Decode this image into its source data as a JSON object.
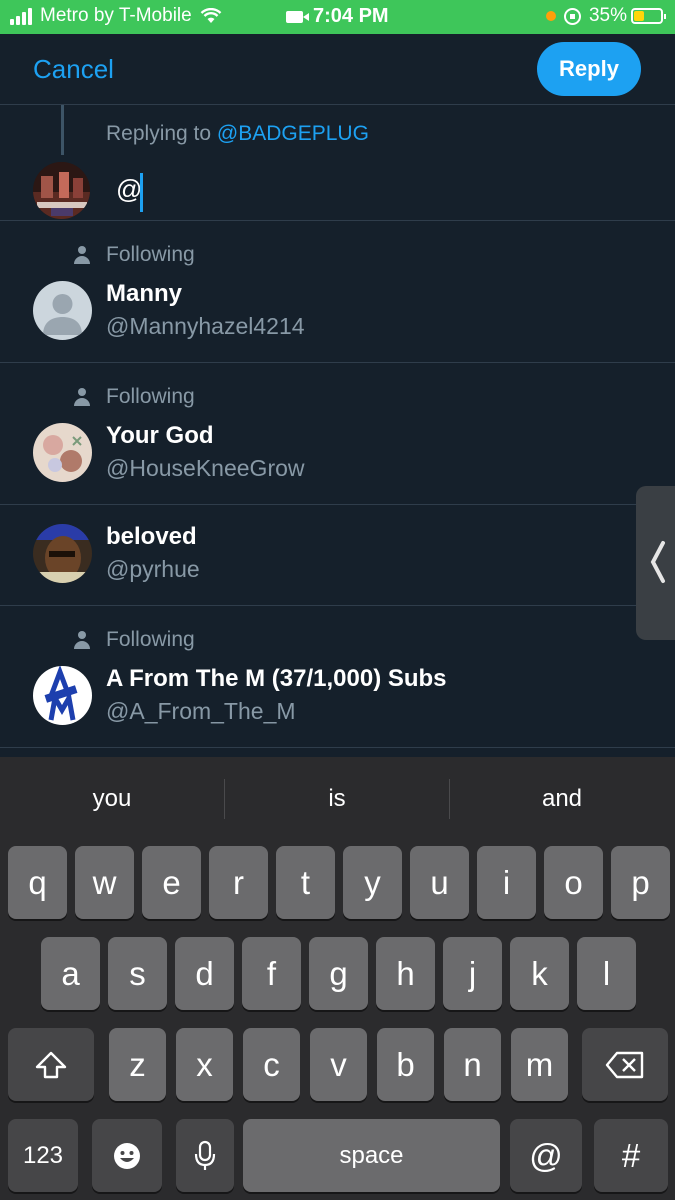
{
  "status_bar": {
    "carrier": "Metro by T-Mobile",
    "time": "7:04 PM",
    "battery": "35%",
    "battery_level": 0.35
  },
  "header": {
    "cancel_label": "Cancel",
    "reply_label": "Reply"
  },
  "compose": {
    "replying_prefix": "Replying to",
    "replying_handle": "@BADGEPLUG",
    "text": "@"
  },
  "suggestions": [
    {
      "following": "Following",
      "name": "Manny",
      "handle": "@Mannyhazel4214"
    },
    {
      "following": "Following",
      "name": "Your God",
      "handle": "@HouseKneeGrow"
    },
    {
      "following": "",
      "name": "beloved",
      "handle": "@pyrhue"
    },
    {
      "following": "Following",
      "name": "A From The M (37/1,000) Subs",
      "handle": "@A_From_The_M"
    }
  ],
  "keyboard": {
    "predictions": [
      "you",
      "is",
      "and"
    ],
    "row1": [
      "q",
      "w",
      "e",
      "r",
      "t",
      "y",
      "u",
      "i",
      "o",
      "p"
    ],
    "row2": [
      "a",
      "s",
      "d",
      "f",
      "g",
      "h",
      "j",
      "k",
      "l"
    ],
    "row3": [
      "z",
      "x",
      "c",
      "v",
      "b",
      "n",
      "m"
    ],
    "numbers_label": "123",
    "space_label": "space",
    "at_label": "@",
    "hash_label": "#"
  },
  "colors": {
    "accent": "#1da1f2",
    "background": "#15202b",
    "status_bar": "#3ec65a",
    "secondary_text": "#8899a6"
  },
  "icons": [
    "signal-icon",
    "wifi-icon",
    "camera-icon",
    "orange-dot-icon",
    "rotation-lock-icon",
    "battery-icon",
    "person-icon",
    "chevron-left-icon",
    "shift-icon",
    "backspace-icon",
    "emoji-icon",
    "microphone-icon"
  ]
}
